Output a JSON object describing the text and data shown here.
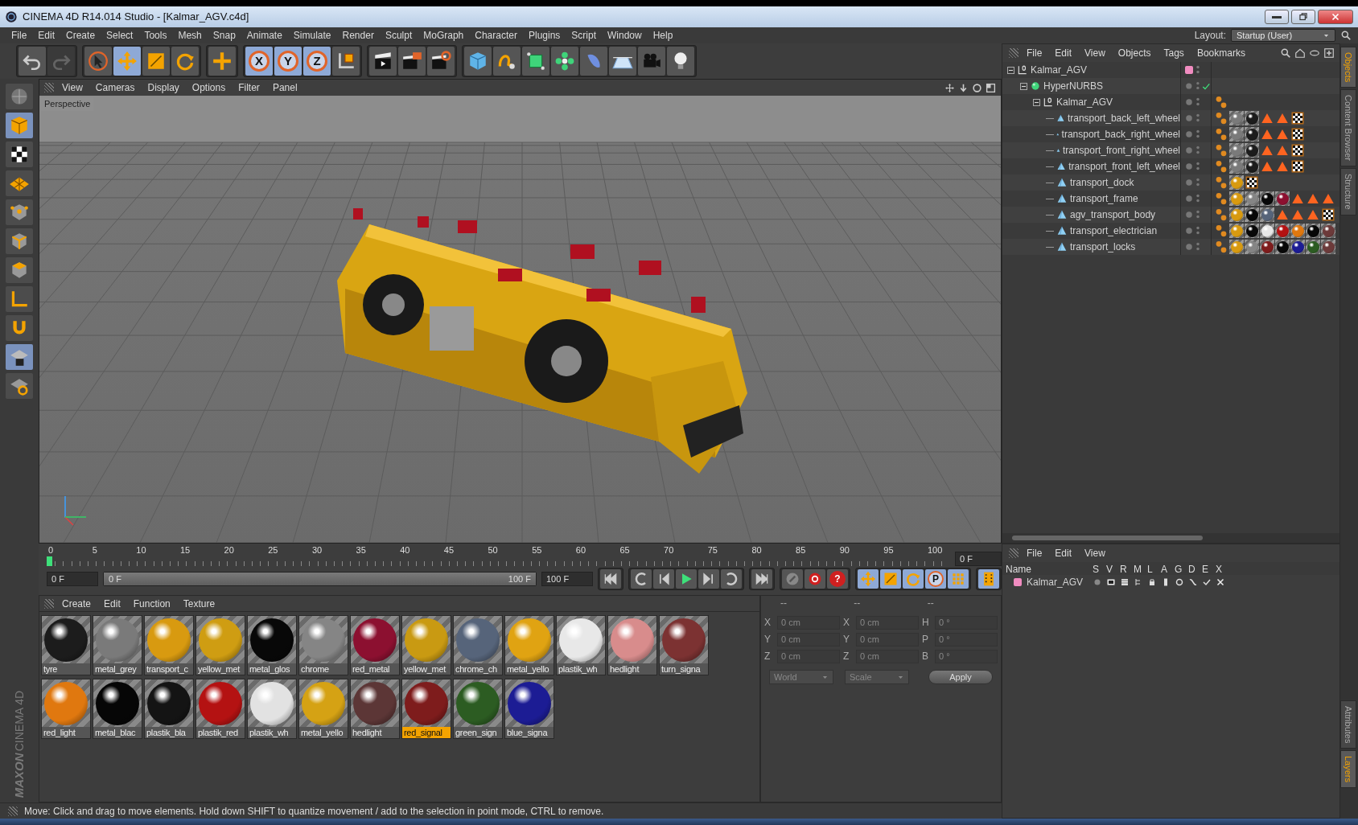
{
  "window": {
    "title": "CINEMA 4D R14.014 Studio - [Kalmar_AGV.c4d]"
  },
  "menu_bar": [
    "File",
    "Edit",
    "Create",
    "Select",
    "Tools",
    "Mesh",
    "Snap",
    "Animate",
    "Simulate",
    "Render",
    "Sculpt",
    "MoGraph",
    "Character",
    "Plugins",
    "Script",
    "Window",
    "Help"
  ],
  "layout": {
    "label": "Layout:",
    "value": "Startup (User)"
  },
  "toolbar": {
    "groups": [
      {
        "items": [
          {
            "kind": "undo",
            "selected": false,
            "disabled": false
          },
          {
            "kind": "redo",
            "selected": false,
            "disabled": true
          }
        ]
      },
      {
        "items": [
          {
            "kind": "select",
            "selected": false,
            "disabled": false
          },
          {
            "kind": "move",
            "selected": true,
            "disabled": false
          },
          {
            "kind": "scale",
            "selected": false,
            "disabled": false
          },
          {
            "kind": "rotate",
            "selected": false,
            "disabled": false
          }
        ]
      },
      {
        "items": [
          {
            "kind": "add",
            "selected": false,
            "disabled": false
          }
        ]
      },
      {
        "items": [
          {
            "kind": "axis",
            "label": "X",
            "selected": true,
            "disabled": false
          },
          {
            "kind": "axis",
            "label": "Y",
            "selected": true,
            "disabled": false
          },
          {
            "kind": "axis",
            "label": "Z",
            "selected": true,
            "disabled": false
          },
          {
            "kind": "coord",
            "selected": false,
            "disabled": false
          }
        ]
      },
      {
        "items": [
          {
            "kind": "render-view",
            "selected": false,
            "disabled": false
          },
          {
            "kind": "render-picture",
            "selected": false,
            "disabled": false
          },
          {
            "kind": "render-settings",
            "selected": false,
            "disabled": false
          }
        ]
      },
      {
        "items": [
          {
            "kind": "cube",
            "selected": false,
            "disabled": false
          },
          {
            "kind": "spline",
            "selected": false,
            "disabled": false
          },
          {
            "kind": "nurbs",
            "selected": false,
            "disabled": false
          },
          {
            "kind": "array",
            "selected": false,
            "disabled": false
          },
          {
            "kind": "deformer",
            "selected": false,
            "disabled": false
          },
          {
            "kind": "floor",
            "selected": false,
            "disabled": false
          },
          {
            "kind": "camera",
            "selected": false,
            "disabled": false
          },
          {
            "kind": "light",
            "selected": false,
            "disabled": false
          }
        ]
      }
    ]
  },
  "left_toolbar": [
    {
      "kind": "view",
      "selected": false
    },
    {
      "kind": "model",
      "selected": true
    },
    {
      "kind": "texture",
      "selected": false
    },
    {
      "kind": "workplane",
      "selected": false
    },
    {
      "kind": "points",
      "selected": false
    },
    {
      "kind": "edges",
      "selected": false
    },
    {
      "kind": "polygons",
      "selected": false
    },
    {
      "kind": "axis",
      "selected": false
    },
    {
      "kind": "magnet",
      "selected": false
    },
    {
      "kind": "snap",
      "selected": true
    },
    {
      "kind": "snap-settings",
      "selected": false
    }
  ],
  "viewport": {
    "menu": [
      "View",
      "Cameras",
      "Display",
      "Options",
      "Filter",
      "Panel"
    ],
    "camera": "Perspective"
  },
  "timeline": {
    "ticks": [
      "0",
      "5",
      "10",
      "15",
      "20",
      "25",
      "30",
      "35",
      "40",
      "45",
      "50",
      "55",
      "60",
      "65",
      "70",
      "75",
      "80",
      "85",
      "90",
      "95",
      "100"
    ],
    "current": "0 F",
    "start": "0 F",
    "range": {
      "start": "0 F",
      "end": "100 F",
      "level": 1
    },
    "end": "100 F",
    "controls": [
      {
        "kind": "first",
        "selected": false
      },
      {
        "kind": "loop-back",
        "selected": false
      },
      {
        "kind": "prev",
        "selected": false
      },
      {
        "kind": "play",
        "selected": false
      },
      {
        "kind": "next",
        "selected": false
      },
      {
        "kind": "loop",
        "selected": false
      },
      {
        "kind": "last",
        "selected": false
      },
      {
        "kind": "keylink",
        "selected": false
      },
      {
        "kind": "record",
        "selected": false
      },
      {
        "kind": "help",
        "label": "?",
        "selected": false
      },
      {
        "kind": "key-move",
        "selected": true
      },
      {
        "kind": "key-scale",
        "selected": true
      },
      {
        "kind": "key-rotate",
        "selected": true
      },
      {
        "kind": "key-param",
        "label": "P",
        "selected": true
      },
      {
        "kind": "key-points",
        "selected": true
      },
      {
        "kind": "timeline",
        "selected": true
      }
    ]
  },
  "materials": {
    "menu": [
      "Create",
      "Edit",
      "Function",
      "Texture"
    ],
    "items": [
      {
        "name": "tyre",
        "color": "#1c1c1c",
        "selected": false
      },
      {
        "name": "metal_grey",
        "color": "#7a7a7a",
        "selected": false
      },
      {
        "name": "transport_c",
        "color": "#d89a10",
        "selected": false
      },
      {
        "name": "yellow_met",
        "color": "#cf9d12",
        "selected": false
      },
      {
        "name": "metal_glos",
        "color": "#080808",
        "selected": false
      },
      {
        "name": "chrome",
        "color": "#858585",
        "selected": false
      },
      {
        "name": "red_metal",
        "color": "#8c1030",
        "selected": false
      },
      {
        "name": "yellow_met",
        "color": "#c99a12",
        "selected": false
      },
      {
        "name": "chrome_ch",
        "color": "#56647a",
        "selected": false
      },
      {
        "name": "metal_yello",
        "color": "#e0a312",
        "selected": false
      },
      {
        "name": "plastik_wh",
        "color": "#e8e8e8",
        "selected": false
      },
      {
        "name": "hedlight",
        "color": "#d88c8c",
        "selected": false
      },
      {
        "name": "turn_signa",
        "color": "#7c3232",
        "selected": false
      },
      {
        "name": "red_light",
        "color": "#e0780f",
        "selected": false
      },
      {
        "name": "metal_blac",
        "color": "#060606",
        "selected": false
      },
      {
        "name": "plastik_bla",
        "color": "#141414",
        "selected": false
      },
      {
        "name": "plastik_red",
        "color": "#b41212",
        "selected": false
      },
      {
        "name": "plastik_wh",
        "color": "#e2e2e2",
        "selected": false
      },
      {
        "name": "metal_yello",
        "color": "#d5a214",
        "selected": false
      },
      {
        "name": "hedlight",
        "color": "#5c3636",
        "selected": false
      },
      {
        "name": "red_signal",
        "color": "#7e1c1c",
        "selected": true
      },
      {
        "name": "green_sign",
        "color": "#2c5c22",
        "selected": false
      },
      {
        "name": "blue_signa",
        "color": "#1c1c94",
        "selected": false
      }
    ]
  },
  "coordinates": {
    "headers": [
      "--",
      "--",
      "--"
    ],
    "rows": [
      {
        "fields": [
          {
            "label": "X",
            "value": "0 cm"
          },
          {
            "label": "X",
            "value": "0 cm"
          },
          {
            "label": "H",
            "value": "0 °"
          }
        ]
      },
      {
        "fields": [
          {
            "label": "Y",
            "value": "0 cm"
          },
          {
            "label": "Y",
            "value": "0 cm"
          },
          {
            "label": "P",
            "value": "0 °"
          }
        ]
      },
      {
        "fields": [
          {
            "label": "Z",
            "value": "0 cm"
          },
          {
            "label": "Z",
            "value": "0 cm"
          },
          {
            "label": "B",
            "value": "0 °"
          }
        ]
      }
    ],
    "dropdowns": [
      "World",
      "Scale"
    ],
    "apply": "Apply"
  },
  "object_manager": {
    "menu": [
      "File",
      "Edit",
      "View",
      "Objects",
      "Tags",
      "Bookmarks"
    ],
    "objects": [
      {
        "name": "Kalmar_AGV",
        "kind": "null",
        "expanded": true,
        "color": "#f08cc0",
        "children": [
          {
            "name": "HyperNURBS",
            "kind": "hypernurbs",
            "expanded": true,
            "enabled": true,
            "children": [
              {
                "name": "Kalmar_AGV",
                "kind": "null",
                "expanded": true,
                "tags": [
                  {
                    "kind": "phong"
                  }
                ],
                "children": [
                  {
                    "name": "transport_back_left_wheel",
                    "kind": "polygon",
                    "tags": [
                      {
                        "kind": "phong"
                      },
                      {
                        "kind": "material",
                        "color": "#7a7a7a"
                      },
                      {
                        "kind": "material",
                        "color": "#1c1c1c"
                      },
                      {
                        "kind": "selection"
                      },
                      {
                        "kind": "selection"
                      },
                      {
                        "kind": "uvw"
                      }
                    ]
                  },
                  {
                    "name": "transport_back_right_wheel",
                    "kind": "polygon",
                    "tags": [
                      {
                        "kind": "phong"
                      },
                      {
                        "kind": "material",
                        "color": "#7a7a7a"
                      },
                      {
                        "kind": "material",
                        "color": "#1c1c1c"
                      },
                      {
                        "kind": "selection"
                      },
                      {
                        "kind": "selection"
                      },
                      {
                        "kind": "uvw"
                      }
                    ]
                  },
                  {
                    "name": "transport_front_right_wheel",
                    "kind": "polygon",
                    "tags": [
                      {
                        "kind": "phong"
                      },
                      {
                        "kind": "material",
                        "color": "#7a7a7a"
                      },
                      {
                        "kind": "material",
                        "color": "#1c1c1c"
                      },
                      {
                        "kind": "selection"
                      },
                      {
                        "kind": "selection"
                      },
                      {
                        "kind": "uvw"
                      }
                    ]
                  },
                  {
                    "name": "transport_front_left_wheel",
                    "kind": "polygon",
                    "tags": [
                      {
                        "kind": "phong"
                      },
                      {
                        "kind": "material",
                        "color": "#7a7a7a"
                      },
                      {
                        "kind": "material",
                        "color": "#1c1c1c"
                      },
                      {
                        "kind": "selection"
                      },
                      {
                        "kind": "selection"
                      },
                      {
                        "kind": "uvw"
                      }
                    ]
                  },
                  {
                    "name": "transport_dock",
                    "kind": "polygon",
                    "tags": [
                      {
                        "kind": "phong"
                      },
                      {
                        "kind": "material",
                        "color": "#d89a10"
                      },
                      {
                        "kind": "uvw"
                      }
                    ]
                  },
                  {
                    "name": "transport_frame",
                    "kind": "polygon",
                    "tags": [
                      {
                        "kind": "phong"
                      },
                      {
                        "kind": "material",
                        "color": "#d89a10"
                      },
                      {
                        "kind": "material",
                        "color": "#858585"
                      },
                      {
                        "kind": "material",
                        "color": "#080808"
                      },
                      {
                        "kind": "material",
                        "color": "#8c1030"
                      },
                      {
                        "kind": "selection"
                      },
                      {
                        "kind": "selection"
                      },
                      {
                        "kind": "selection"
                      }
                    ]
                  },
                  {
                    "name": "agv_transport_body",
                    "kind": "polygon",
                    "tags": [
                      {
                        "kind": "phong"
                      },
                      {
                        "kind": "material",
                        "color": "#d89a10"
                      },
                      {
                        "kind": "material",
                        "color": "#080808"
                      },
                      {
                        "kind": "material",
                        "color": "#56647a"
                      },
                      {
                        "kind": "selection"
                      },
                      {
                        "kind": "selection"
                      },
                      {
                        "kind": "selection"
                      },
                      {
                        "kind": "uvw"
                      }
                    ]
                  },
                  {
                    "name": "transport_electrician",
                    "kind": "polygon",
                    "tags": [
                      {
                        "kind": "phong"
                      },
                      {
                        "kind": "material",
                        "color": "#d89a10"
                      },
                      {
                        "kind": "material",
                        "color": "#080808"
                      },
                      {
                        "kind": "material",
                        "color": "#e8e8e8"
                      },
                      {
                        "kind": "material",
                        "color": "#b41212"
                      },
                      {
                        "kind": "material",
                        "color": "#e0780f"
                      },
                      {
                        "kind": "material",
                        "color": "#060606"
                      },
                      {
                        "kind": "material",
                        "color": "#6c3a3a"
                      }
                    ]
                  },
                  {
                    "name": "transport_locks",
                    "kind": "polygon",
                    "tags": [
                      {
                        "kind": "phong"
                      },
                      {
                        "kind": "material",
                        "color": "#d89a10"
                      },
                      {
                        "kind": "material",
                        "color": "#858585"
                      },
                      {
                        "kind": "material",
                        "color": "#7e1c1c"
                      },
                      {
                        "kind": "material",
                        "color": "#080808"
                      },
                      {
                        "kind": "material",
                        "color": "#1c1c94"
                      },
                      {
                        "kind": "material",
                        "color": "#2c5c22"
                      },
                      {
                        "kind": "material",
                        "color": "#6c3a3a"
                      }
                    ]
                  }
                ]
              }
            ]
          }
        ]
      }
    ]
  },
  "attributes": {
    "menu": [
      "File",
      "Edit",
      "View"
    ],
    "columns": [
      "Name",
      "S",
      "V",
      "R",
      "M",
      "L",
      "A",
      "G",
      "D",
      "E",
      "X"
    ],
    "rows": [
      {
        "name": "Kalmar_AGV",
        "color": "#f08cc0"
      }
    ]
  },
  "side_tabs": {
    "top": [
      {
        "label": "Objects",
        "selected": true
      },
      {
        "label": "Content Browser",
        "selected": false
      },
      {
        "label": "Structure",
        "selected": false
      }
    ],
    "bottom": [
      {
        "label": "Attributes",
        "selected": false
      },
      {
        "label": "Layers",
        "selected": true
      }
    ]
  },
  "brand": {
    "company": "MAXON",
    "product": "CINEMA 4D"
  },
  "status_bar": "Move: Click and drag to move elements. Hold down SHIFT to quantize movement / add to the selection in point mode, CTRL to remove."
}
